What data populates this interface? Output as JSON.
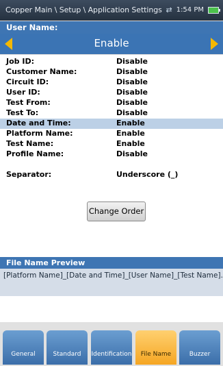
{
  "status_bar": {
    "breadcrumb": "Copper Main \\ Setup \\ Application Settings",
    "time": "1:54 PM",
    "icons": [
      "sync-icon",
      "battery-icon"
    ]
  },
  "selector": {
    "title": "User Name:",
    "value": "Enable"
  },
  "fields": [
    {
      "label": "Job ID:",
      "value": "Disable"
    },
    {
      "label": "Customer Name:",
      "value": "Disable"
    },
    {
      "label": "Circuit ID:",
      "value": "Disable"
    },
    {
      "label": "User ID:",
      "value": "Disable"
    },
    {
      "label": "Test From:",
      "value": "Disable"
    },
    {
      "label": "Test To:",
      "value": "Disable"
    },
    {
      "label": "Date and Time:",
      "value": "Enable"
    },
    {
      "label": "Platform Name:",
      "value": "Enable"
    },
    {
      "label": "Test Name:",
      "value": "Enable"
    },
    {
      "label": "Profile Name:",
      "value": "Disable"
    }
  ],
  "separator": {
    "label": "Separator:",
    "value": "Underscore (_)"
  },
  "change_order_label": "Change Order",
  "preview": {
    "title": "File Name Preview",
    "text": "[Platform Name]_[Date and Time]_[User Name]_[Test Name].cq"
  },
  "tabs": [
    {
      "label": "General"
    },
    {
      "label": "Standard"
    },
    {
      "label": "Identification"
    },
    {
      "label": "File Name"
    },
    {
      "label": "Buzzer"
    }
  ],
  "colors": {
    "header": "#3e75b3",
    "highlight_row": "#bcd0e6",
    "active_tab": "#f5a623",
    "arrow": "#f5b800"
  }
}
